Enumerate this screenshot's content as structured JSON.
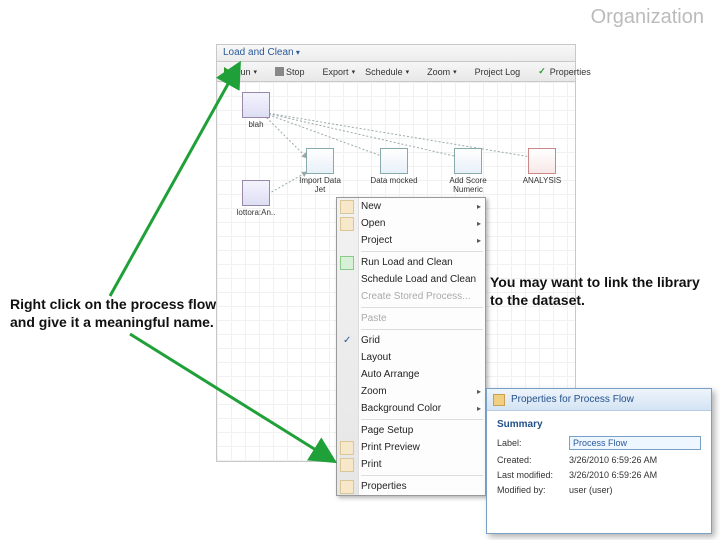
{
  "slide": {
    "title": "Organization"
  },
  "app": {
    "menu": {
      "load_clean": "Load and Clean"
    },
    "toolbar": {
      "run": "Run",
      "stop": "Stop",
      "export": "Export",
      "schedule": "Schedule",
      "zoom": "Zoom",
      "project_log": "Project Log",
      "properties": "Properties"
    },
    "nodes": {
      "blah": "blah",
      "lottora": "lottora:An..",
      "import": "Import Data Jet",
      "data_mocked": "Data mocked",
      "add_score": "Add Score Numeric",
      "analysis": "ANALYSIS"
    }
  },
  "context_menu": {
    "new": "New",
    "open": "Open",
    "project": "Project",
    "run": "Run Load and Clean",
    "schedule": "Schedule Load and Clean",
    "stored": "Create Stored Process...",
    "paste": "Paste",
    "grid": "Grid",
    "layout": "Layout",
    "auto_arrange": "Auto Arrange",
    "zoom_c": "Zoom",
    "bgcolor": "Background Color",
    "page_setup": "Page Setup",
    "preview": "Print Preview",
    "print": "Print",
    "properties": "Properties"
  },
  "callouts": {
    "left": "Right click on the process flow and give it a meaningful name.",
    "right": "You may want to link the library to the dataset."
  },
  "props": {
    "title": "Properties for Process Flow",
    "section": "Summary",
    "label_lab": "Label:",
    "label_val": "Process Flow",
    "created_lab": "Created:",
    "created_val": "3/26/2010 6:59:26 AM",
    "modified_lab": "Last modified:",
    "modified_val": "3/26/2010 6:59:26 AM",
    "by_lab": "Modified by:",
    "by_val": "user (user)"
  }
}
